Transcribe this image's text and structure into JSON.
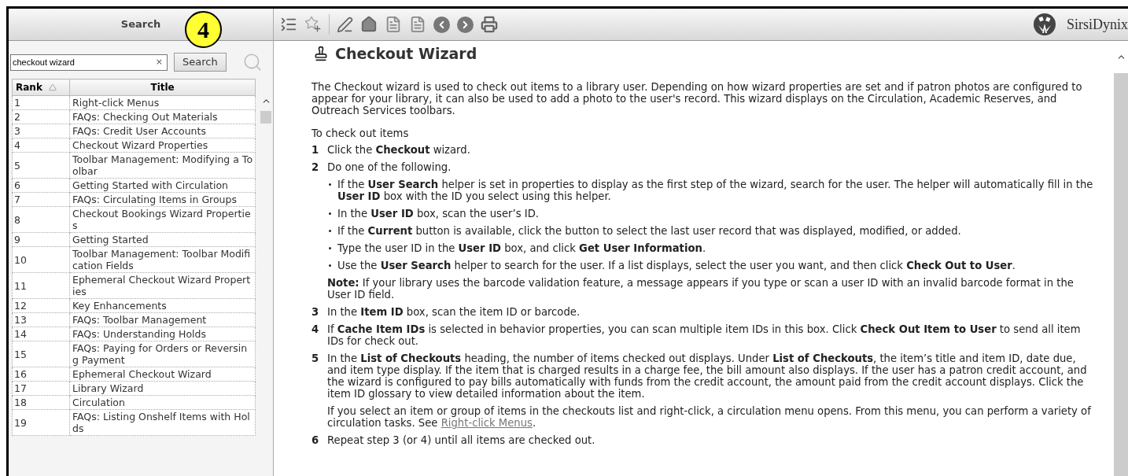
{
  "callout": {
    "label": "4"
  },
  "search_panel": {
    "title": "Search",
    "field": {
      "value": "checkout wizard",
      "clear": "×"
    },
    "button": "Search",
    "table": {
      "columns": [
        {
          "label": "Rank",
          "sorted_ascending": true
        },
        {
          "label": "Title"
        }
      ],
      "rows": [
        {
          "rank": "1",
          "title": "Right-click Menus"
        },
        {
          "rank": "2",
          "title": "FAQs: Checking Out Materials"
        },
        {
          "rank": "3",
          "title": "FAQs: Credit User Accounts"
        },
        {
          "rank": "4",
          "title": "Checkout Wizard Properties"
        },
        {
          "rank": "5",
          "title": "Toolbar Management: Modifying a Toolbar"
        },
        {
          "rank": "6",
          "title": "Getting Started with Circulation"
        },
        {
          "rank": "7",
          "title": "FAQs: Circulating Items in Groups"
        },
        {
          "rank": "8",
          "title": "Checkout Bookings Wizard Properties"
        },
        {
          "rank": "9",
          "title": "Getting Started"
        },
        {
          "rank": "10",
          "title": "Toolbar Management: Toolbar Modification Fields"
        },
        {
          "rank": "11",
          "title": "Ephemeral Checkout Wizard Properties"
        },
        {
          "rank": "12",
          "title": "Key Enhancements"
        },
        {
          "rank": "13",
          "title": "FAQs: Toolbar Management"
        },
        {
          "rank": "14",
          "title": "FAQs: Understanding Holds"
        },
        {
          "rank": "15",
          "title": "FAQs: Paying for Orders or Reversing Payment"
        },
        {
          "rank": "16",
          "title": "Ephemeral Checkout Wizard"
        },
        {
          "rank": "17",
          "title": "Library Wizard"
        },
        {
          "rank": "18",
          "title": "Circulation"
        },
        {
          "rank": "19",
          "title": "FAQs: Listing Onshelf Items with Holds"
        }
      ]
    }
  },
  "toolbar": {
    "logo": "SirsiDynix"
  },
  "article": {
    "title": "Checkout Wizard",
    "intro": "The Checkout wizard is used to check out items to a library user. Depending on how wizard properties are set and if patron photos are configured to appear for your library, it can also be used to add a photo to the user's record. This wizard displays on the Circulation, Academic Reserves, and Outreach Services toolbars.",
    "section": "To check out items",
    "steps": [
      {
        "number": "1",
        "text": "Click the **Checkout** wizard."
      },
      {
        "number": "2",
        "text": "Do one of the following.",
        "bullets": [
          "If the **User Search** helper is set in properties to display as the first step of the wizard, search for the user. The helper will automatically fill in the **User ID** box with the ID you select using this helper.",
          "In the **User ID** box, scan the user’s ID.",
          "If the **Current** button is available, click the button to select the last user record that was displayed, modified, or added.",
          "Type the user ID in the **User ID** box, and click **Get User Information**.",
          "Use the **User Search** helper to search for the user. If a list displays, select the user you want, and then click **Check Out to User**."
        ],
        "note": "**Note:** If your library uses the barcode validation feature, a message appears if you type or scan a user ID with an invalid barcode format in the User ID field."
      },
      {
        "number": "3",
        "text": "In the **Item ID** box, scan the item ID or barcode."
      },
      {
        "number": "4",
        "text": "If **Cache Item IDs** is selected in behavior properties, you can scan multiple item IDs in this box. Click **Check Out Item to User** to send all item IDs for check out."
      },
      {
        "number": "5",
        "text": "In the **List of Checkouts** heading, the number of items checked out displays. Under **List of Checkouts**, the item’s title and item ID, date due, and item type display. If the item that is charged results in a charge fee, the bill amount also displays. If the user has a patron credit account, and the wizard is configured to pay bills automatically with funds from the credit account, the amount paid from the credit account displays. Click the item ID glossary to view detailed information about the item.",
        "extra": {
          "before": "If you select an item or group of items in the checkouts list and right-click, a circulation menu opens. From this menu, you can perform a variety of circulation tasks. See ",
          "link": "Right-click Menus",
          "after": "."
        }
      },
      {
        "number": "6",
        "text": "Repeat step 3 (or 4) until all items are checked out."
      }
    ]
  }
}
